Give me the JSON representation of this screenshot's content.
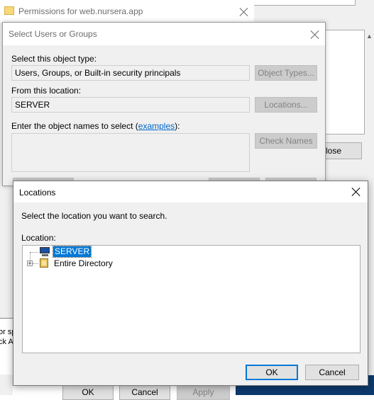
{
  "permissions_window": {
    "title": "Permissions for web.nursera.app",
    "close_fragment": "lose",
    "bottom_buttons": {
      "ok": "OK",
      "cancel": "Cancel",
      "apply": "Apply"
    },
    "side_text_lines": [
      "or sp",
      "ck A"
    ]
  },
  "select_dialog": {
    "title": "Select Users or Groups",
    "object_type_label": "Select this object type:",
    "object_type_value": "Users, Groups, or Built-in security principals",
    "object_types_button": "Object Types...",
    "location_label": "From this location:",
    "location_value": "SERVER",
    "locations_button": "Locations...",
    "names_label_prefix": "Enter the object names to select (",
    "names_label_link": "examples",
    "names_label_suffix": "):",
    "check_names_button": "Check Names"
  },
  "locations_dialog": {
    "title": "Locations",
    "instruction": "Select the location you want to search.",
    "location_label": "Location:",
    "tree": [
      {
        "label": "SERVER",
        "selected": true,
        "icon": "computer-icon"
      },
      {
        "label": "Entire Directory",
        "selected": false,
        "icon": "directory-icon"
      }
    ],
    "ok_button": "OK",
    "cancel_button": "Cancel"
  },
  "colors": {
    "selection": "#0078d7",
    "link": "#0066cc",
    "taskbar": "#0c3a6e"
  }
}
